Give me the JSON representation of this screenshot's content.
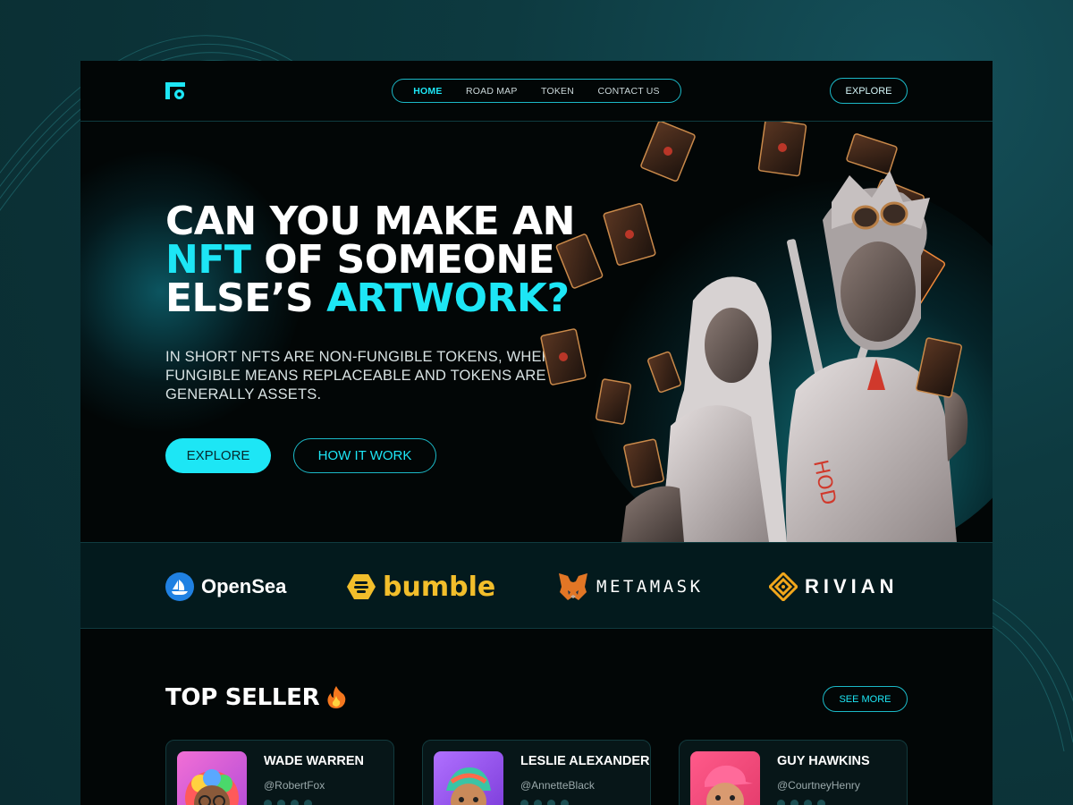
{
  "nav": {
    "logo": "logo-icon",
    "links": [
      {
        "label": "HOME",
        "active": true
      },
      {
        "label": "ROAD MAP",
        "active": false
      },
      {
        "label": "TOKEN",
        "active": false
      },
      {
        "label": "CONTACT US",
        "active": false
      }
    ],
    "explore_label": "EXPLORE"
  },
  "hero": {
    "title_line1": "CAN YOU MAKE AN",
    "title_hl1": "NFT",
    "title_line2_rest": " OF SOMEONE",
    "title_line3_start": "ELSE’S ",
    "title_hl2": "ARTWORK?",
    "subtitle": "IN SHORT NFTS ARE NON-FUNGIBLE TOKENS, WHERE FUNGIBLE MEANS REPLACEABLE AND TOKENS ARE GENERALLY ASSETS.",
    "primary_button": "EXPLORE",
    "secondary_button": "HOW IT WORK"
  },
  "partners": [
    {
      "name": "OpenSea",
      "icon": "opensea-icon"
    },
    {
      "name": "bumble",
      "icon": "bumble-icon"
    },
    {
      "name": "METAMASK",
      "icon": "metamask-fox-icon"
    },
    {
      "name": "RIVIAN",
      "icon": "rivian-icon"
    }
  ],
  "top_seller": {
    "title": "TOP SELLER",
    "icon": "fire-icon",
    "see_more": "SEE MORE",
    "sellers": [
      {
        "name": "WADE WARREN",
        "handle": "@RobertFox"
      },
      {
        "name": "LESLIE ALEXANDER",
        "handle": "@AnnetteBlack"
      },
      {
        "name": "GUY HAWKINS",
        "handle": "@CourtneyHenry"
      }
    ]
  },
  "colors": {
    "accent": "#1de6f5",
    "background": "#020606",
    "outer_background": "#0b3136",
    "bumble_yellow": "#f2be2b"
  }
}
